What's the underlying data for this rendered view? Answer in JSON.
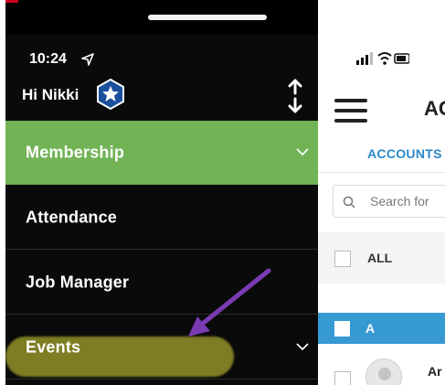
{
  "drawer": {
    "status_time": "10:24",
    "greeting": "Hi Nikki",
    "menu": [
      {
        "label": "Membership",
        "active": true,
        "has_chevron": true
      },
      {
        "label": "Attendance",
        "active": false,
        "has_chevron": false
      },
      {
        "label": "Job Manager",
        "active": false,
        "has_chevron": false
      },
      {
        "label": "Events",
        "active": false,
        "has_chevron": true
      }
    ],
    "icons": {
      "location": "location-arrow-icon",
      "badge": "star-badge-icon",
      "sort": "sort-up-down-icon",
      "chevron": "chevron-down-icon"
    },
    "colors": {
      "background": "#0a0a0a",
      "active_item": "#72b356",
      "highlight": "#929228",
      "annotation_arrow": "#7a3bb0"
    }
  },
  "app": {
    "title": "AC",
    "tab": "ACCOUNTS",
    "search_placeholder": "Search for",
    "all_label": "ALL",
    "section_letter": "A",
    "contact_name": "Ar",
    "colors": {
      "accent": "#2b87c7",
      "section_header": "#3699d2"
    }
  }
}
